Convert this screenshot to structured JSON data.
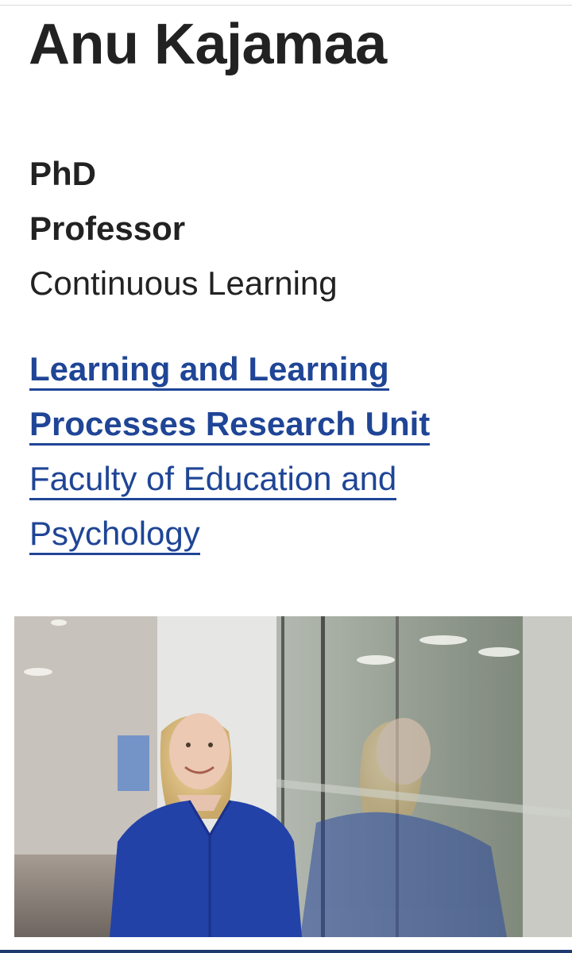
{
  "profile": {
    "name": "Anu Kajamaa",
    "degree": "PhD",
    "title": "Professor",
    "field": "Continuous Learning"
  },
  "affiliations": {
    "unit_line1": "Learning and Learning",
    "unit_line2": "Processes Research Unit",
    "faculty_line1": "Faculty of Education and",
    "faculty_line2": "Psychology"
  },
  "colors": {
    "link": "#1f4596",
    "text": "#222222",
    "accent_bar": "#1f3a6e"
  }
}
